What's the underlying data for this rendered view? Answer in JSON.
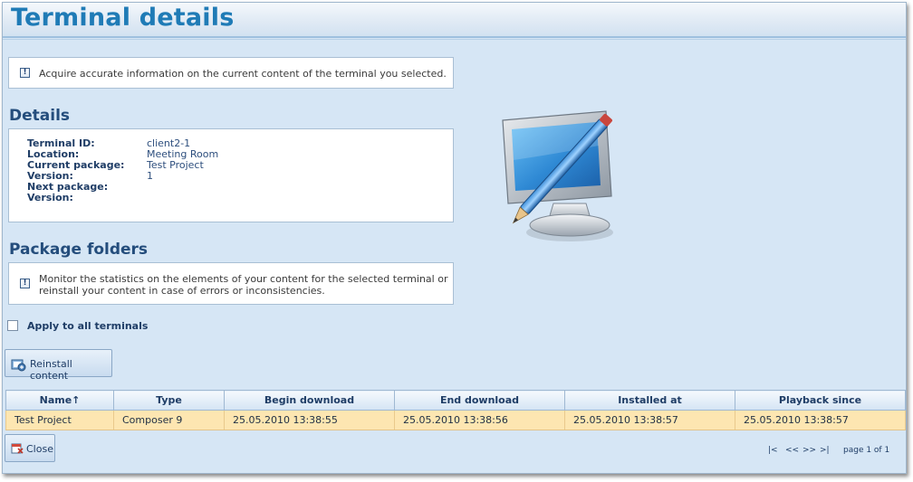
{
  "header": {
    "title": "Terminal details"
  },
  "intro": {
    "icon": "info-icon",
    "text": "Acquire accurate information on the current content of the terminal you selected."
  },
  "details": {
    "heading": "Details",
    "rows": [
      {
        "label": "Terminal ID:",
        "value": "client2-1"
      },
      {
        "label": "Location:",
        "value": "Meeting Room"
      },
      {
        "label": "Current package:",
        "value": "Test Project"
      },
      {
        "label": "Version:",
        "value": "1"
      },
      {
        "label": "Next package:",
        "value": ""
      },
      {
        "label": "Version:",
        "value": ""
      }
    ]
  },
  "package_folders": {
    "heading": "Package folders",
    "info_line1": "Monitor the statistics on the elements of your content for the selected terminal or",
    "info_line2": "reinstall your content in case of errors or inconsistencies.",
    "checkbox_label": "Apply to all terminals",
    "checkbox_checked": false,
    "reinstall_label": "Reinstall content"
  },
  "table": {
    "columns": [
      "Name↑",
      "Type",
      "Begin download",
      "End download",
      "Installed at",
      "Playback since"
    ],
    "rows": [
      [
        "Test Project",
        "Composer 9",
        "25.05.2010 13:38:55",
        "25.05.2010 13:38:56",
        "25.05.2010 13:38:57",
        "25.05.2010 13:38:57"
      ]
    ],
    "selected_row_color": "#fde6b1"
  },
  "footer": {
    "close_label": "Close",
    "pager_first": "|<",
    "pager_prev": "<<",
    "pager_next": ">>",
    "pager_last": ">|",
    "page_text": "page 1 of 1"
  },
  "colors": {
    "title": "#1f7bb6",
    "background": "#d6e6f5",
    "heading": "#244d7c"
  }
}
